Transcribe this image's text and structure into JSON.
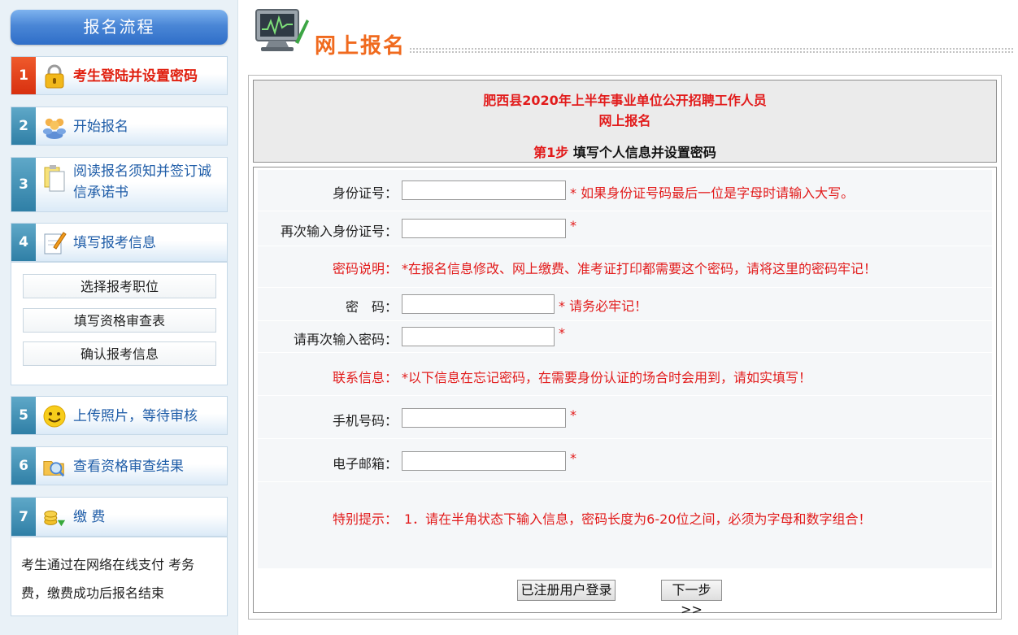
{
  "sidebar": {
    "header": "报名流程",
    "steps": [
      {
        "num": "1",
        "label": "考生登陆并设置密码",
        "icon": "lock-icon"
      },
      {
        "num": "2",
        "label": "开始报名",
        "icon": "users-icon"
      },
      {
        "num": "3",
        "label": "阅读报名须知并签订诚信承诺书",
        "icon": "document-icon"
      },
      {
        "num": "4",
        "label": "填写报考信息",
        "icon": "edit-icon"
      },
      {
        "num": "5",
        "label": "上传照片，等待审核",
        "icon": "smiley-icon"
      },
      {
        "num": "6",
        "label": "查看资格审查结果",
        "icon": "folder-icon"
      },
      {
        "num": "7",
        "label": "缴 费",
        "icon": "coins-icon"
      }
    ],
    "substeps": [
      "选择报考职位",
      "填写资格审查表",
      "确认报考信息"
    ],
    "pay_note": "考生通过在网络在线支付 考务费，缴费成功后报名结束"
  },
  "page": {
    "title": "网上报名"
  },
  "form": {
    "title_line1": "肥西县2020年上半年事业单位公开招聘工作人员",
    "title_line2": "网上报名",
    "step_tag": "第1步",
    "step_desc": "填写个人信息并设置密码",
    "id_label": "身份证号：",
    "id_hint": "* 如果身份证号码最后一位是字母时请输入大写。",
    "id_confirm_label": "再次输入身份证号：",
    "id_confirm_hint": "*",
    "pwd_note_label": "密码说明：",
    "pwd_note_text": "*在报名信息修改、网上缴费、准考证打印都需要这个密码，请将这里的密码牢记！",
    "pwd_label": "密　码：",
    "pwd_hint": "* 请务必牢记！",
    "pwd_confirm_label": "请再次输入密码：",
    "pwd_confirm_hint": "*",
    "contact_label": "联系信息：",
    "contact_text": "*以下信息在忘记密码，在需要身份认证的场合时会用到，请如实填写！",
    "phone_label": "手机号码：",
    "phone_hint": "*",
    "email_label": "电子邮箱：",
    "email_hint": "*",
    "tip_label": "特别提示：",
    "tip_text": "1．请在半角状态下输入信息，密码长度为6-20位之间，必须为字母和数字组合！",
    "login_button": "已注册用户登录",
    "next_button": "下一步>>"
  },
  "colors": {
    "accent_red": "#e21b1b",
    "title_orange": "#f06a1e",
    "link_blue": "#1f5da8",
    "header_blue": "#4a86d6"
  }
}
